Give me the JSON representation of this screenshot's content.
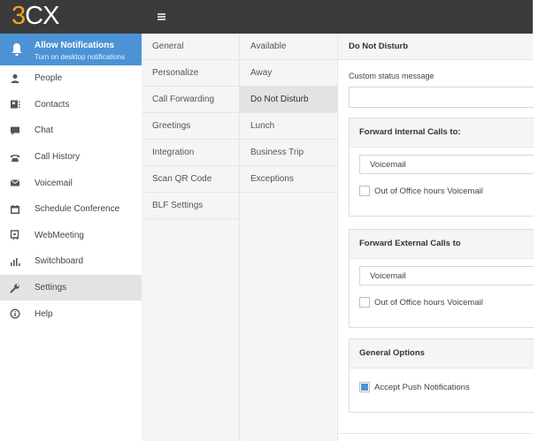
{
  "app": {
    "logo": "3CX",
    "logo_accent": "3",
    "logo_rest": "CX"
  },
  "notification": {
    "title": "Allow Notifications",
    "subtitle": "Turn on desktop notifications"
  },
  "nav": [
    {
      "label": "People",
      "icon": "person-icon"
    },
    {
      "label": "Contacts",
      "icon": "contact-card-icon"
    },
    {
      "label": "Chat",
      "icon": "chat-bubble-icon"
    },
    {
      "label": "Call History",
      "icon": "phone-icon"
    },
    {
      "label": "Voicemail",
      "icon": "envelope-icon"
    },
    {
      "label": "Schedule Conference",
      "icon": "calendar-icon"
    },
    {
      "label": "WebMeeting",
      "icon": "web-meeting-icon"
    },
    {
      "label": "Switchboard",
      "icon": "bar-chart-icon"
    },
    {
      "label": "Settings",
      "icon": "wrench-icon",
      "active": true
    },
    {
      "label": "Help",
      "icon": "info-icon"
    }
  ],
  "settings_menu": [
    "General",
    "Personalize",
    "Call Forwarding",
    "Greetings",
    "Integration",
    "Scan QR Code",
    "BLF Settings"
  ],
  "status_menu": [
    "Available",
    "Away",
    "Do Not Disturb",
    "Lunch",
    "Business Trip",
    "Exceptions"
  ],
  "active_status": "Do Not Disturb",
  "main": {
    "header": "Do Not Disturb",
    "custom_status_label": "Custom status message",
    "custom_status_value": "",
    "internal": {
      "title": "Forward Internal Calls to:",
      "select_value": "Voicemail",
      "checkbox_label": "Out of Office hours Voicemail",
      "checked": false
    },
    "external": {
      "title": "Forward External Calls to",
      "select_value": "Voicemail",
      "checkbox_label": "Out of Office hours Voicemail",
      "checked": false
    },
    "general": {
      "title": "General Options",
      "checkbox_label": "Accept Push Notifications",
      "checked": true
    }
  },
  "colors": {
    "topbar": "#3a3a3a",
    "accent": "#4c93d6",
    "logo_orange": "#f7a21b",
    "active_bg": "#e3e3e3"
  }
}
